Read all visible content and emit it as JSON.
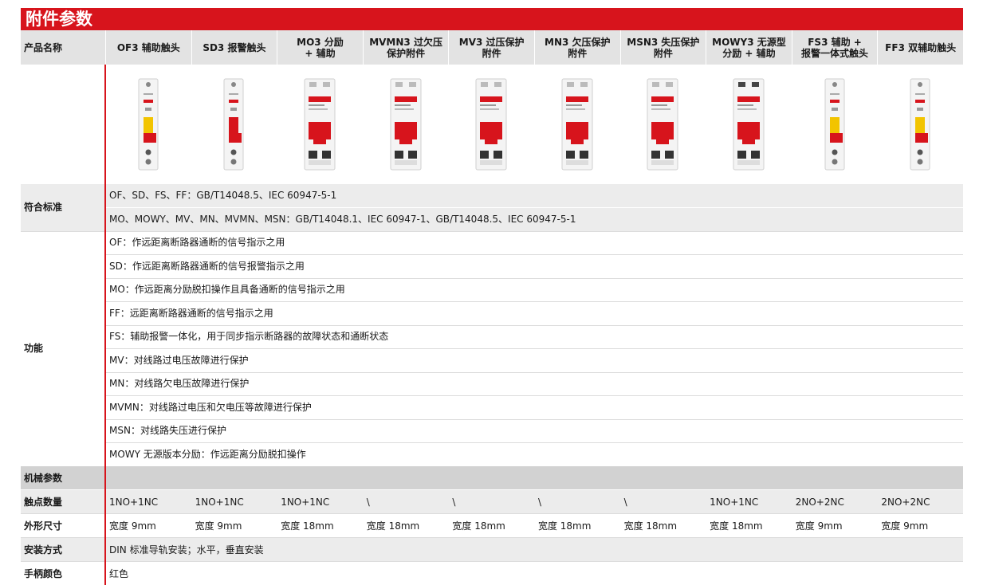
{
  "title": "附件参数",
  "header": {
    "row_label": "产品名称",
    "products": [
      {
        "label": "OF3 辅助触头",
        "width": "narrow"
      },
      {
        "label": "SD3 报警触头",
        "width": "narrow"
      },
      {
        "label": "MO3 分励\n+ 辅助",
        "width": "wide"
      },
      {
        "label": "MVMN3 过欠压\n保护附件",
        "width": "wide"
      },
      {
        "label": "MV3 过压保护\n附件",
        "width": "wide"
      },
      {
        "label": "MN3 欠压保护\n附件",
        "width": "wide"
      },
      {
        "label": "MSN3 失压保护\n附件",
        "width": "wide"
      },
      {
        "label": "MOWY3 无源型\n分励 + 辅助",
        "width": "wide"
      },
      {
        "label": "FS3 辅助 +\n报警一体式触头",
        "width": "narrow"
      },
      {
        "label": "FF3 双辅助触头",
        "width": "narrow"
      }
    ]
  },
  "standards": {
    "label": "符合标准",
    "lines": [
      "OF、SD、FS、FF：GB/T14048.5、IEC 60947-5-1",
      "MO、MOWY、MV、MN、MVMN、MSN：GB/T14048.1、IEC 60947-1、GB/T14048.5、IEC 60947-5-1"
    ]
  },
  "functions": {
    "label": "功能",
    "lines": [
      "OF：作远距离断路器通断的信号指示之用",
      "SD：作远距离断路器通断的信号报警指示之用",
      "MO：作远距离分励脱扣操作且具备通断的信号指示之用",
      "FF：远距离断路器通断的信号指示之用",
      "FS：辅助报警一体化，用于同步指示断路器的故障状态和通断状态",
      "MV：对线路过电压故障进行保护",
      "MN：对线路欠电压故障进行保护",
      "MVMN：对线路过电压和欠电压等故障进行保护",
      "MSN：对线路失压进行保护",
      "MOWY 无源版本分励：作远距离分励脱扣操作"
    ]
  },
  "mechanical": {
    "label": "机械参数"
  },
  "contacts": {
    "label": "触点数量",
    "values": [
      "1NO+1NC",
      "1NO+1NC",
      "1NO+1NC",
      "\\",
      "\\",
      "\\",
      "\\",
      "1NO+1NC",
      "2NO+2NC",
      "2NO+2NC"
    ]
  },
  "dimensions": {
    "label": "外形尺寸",
    "values": [
      "宽度 9mm",
      "宽度 9mm",
      "宽度 18mm",
      "宽度 18mm",
      "宽度 18mm",
      "宽度 18mm",
      "宽度 18mm",
      "宽度 18mm",
      "宽度 9mm",
      "宽度 9mm"
    ]
  },
  "mounting": {
    "label": "安装方式",
    "value": "DIN 标准导轨安装；水平，垂直安装"
  },
  "handle_color": {
    "label": "手柄颜色",
    "value": "红色"
  },
  "colors": {
    "brand_red": "#d7141c",
    "handle_yellow": "#f2c400"
  }
}
